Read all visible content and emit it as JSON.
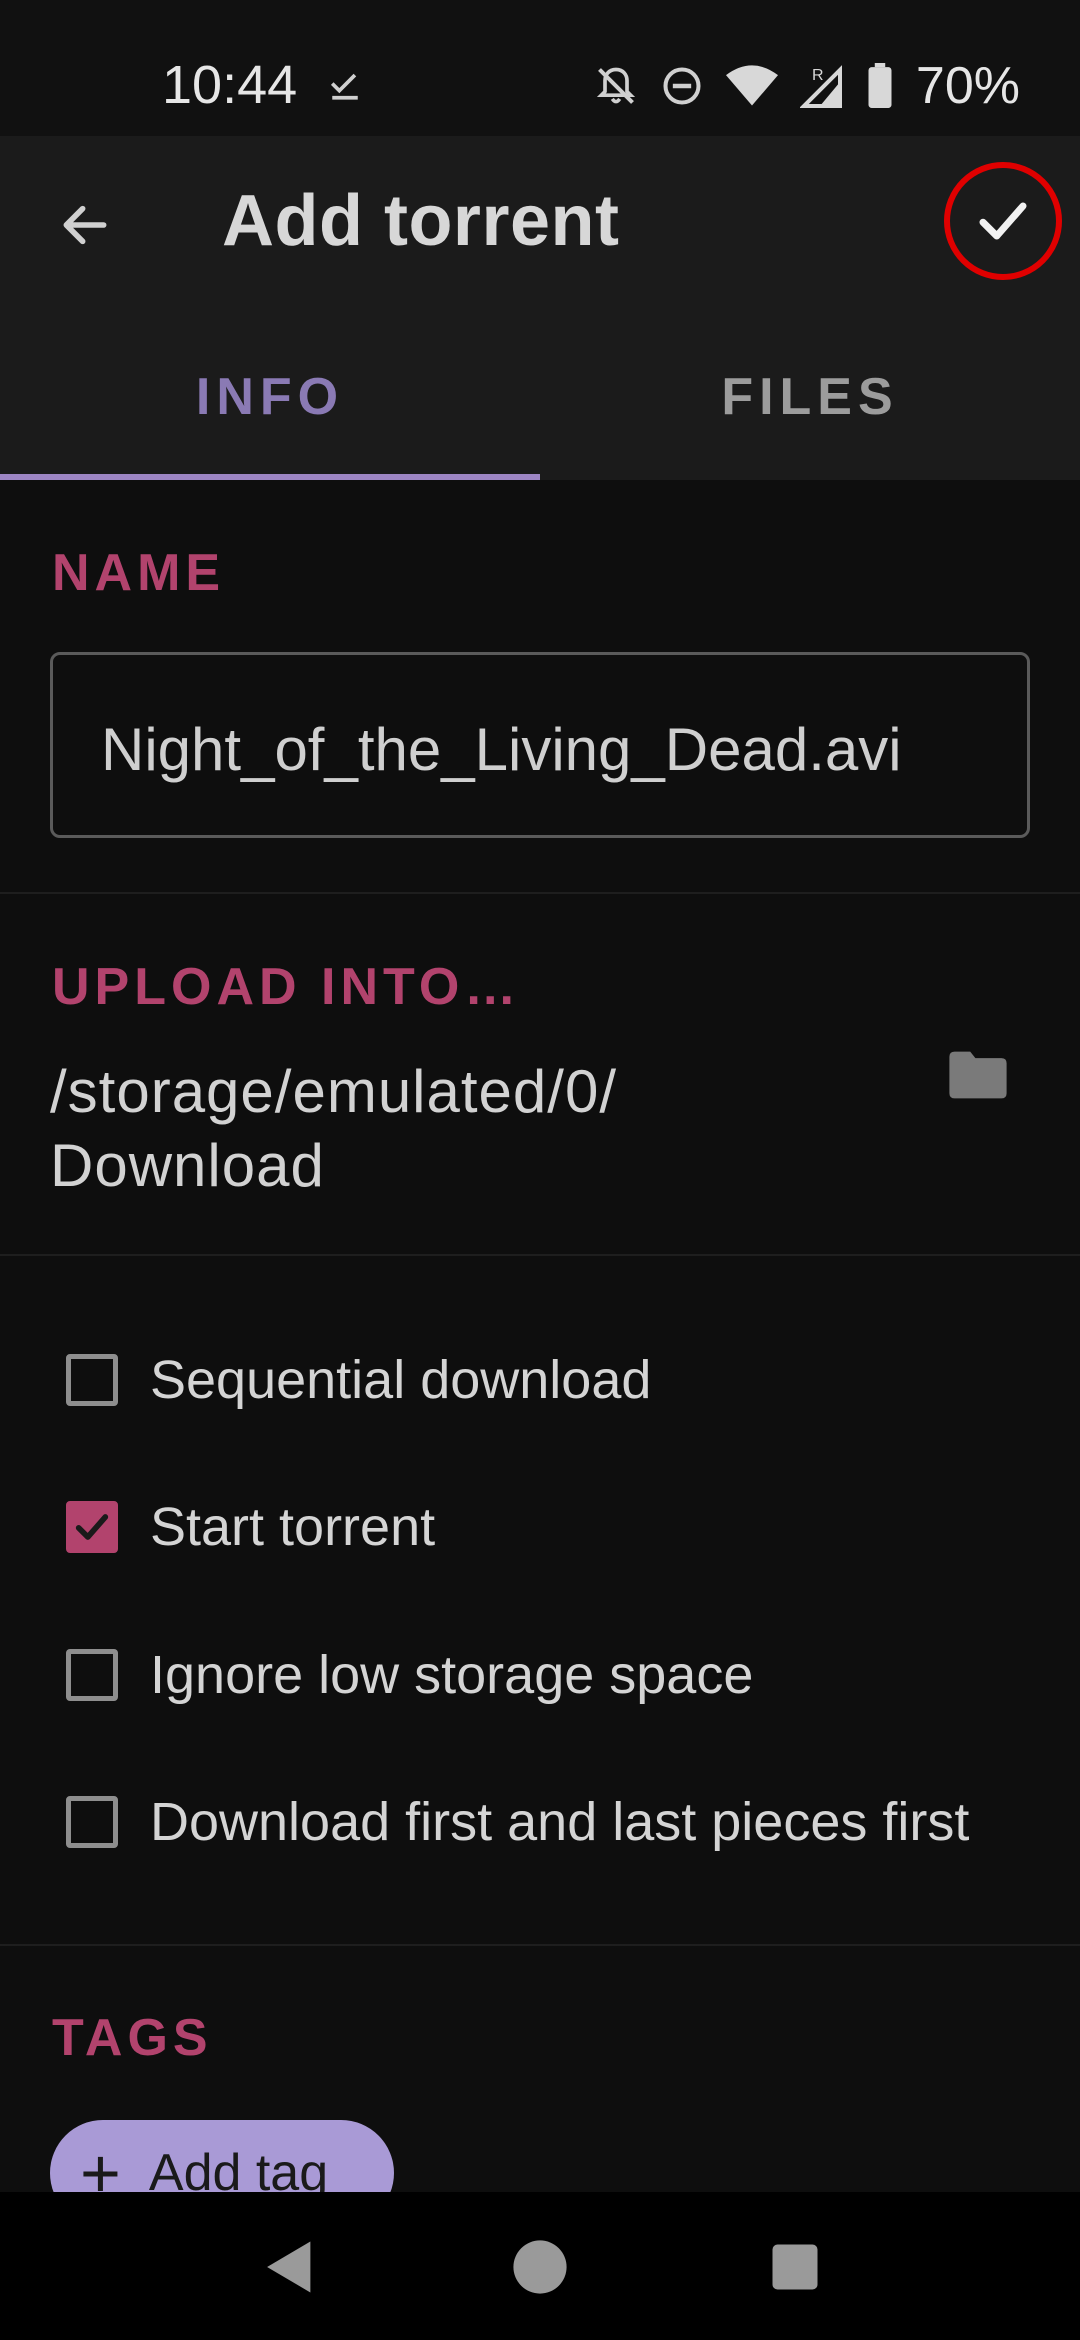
{
  "status_bar": {
    "time": "10:44",
    "battery_percent": "70%",
    "icons": [
      "download-complete-icon",
      "notifications-off-icon",
      "do-not-disturb-icon",
      "wifi-icon",
      "signal-roaming-icon",
      "battery-icon"
    ]
  },
  "app_bar": {
    "title": "Add torrent",
    "back_icon": "arrow-left-icon",
    "confirm_icon": "check-icon"
  },
  "tabs": [
    {
      "label": "INFO",
      "selected": true
    },
    {
      "label": "FILES",
      "selected": false
    }
  ],
  "name_section": {
    "label": "NAME",
    "value": "Night_of_the_Living_Dead.avi"
  },
  "upload_section": {
    "label": "UPLOAD INTO…",
    "path_line1": "/storage/emulated/0/",
    "path_line2": "Download",
    "folder_icon": "folder-icon"
  },
  "options": [
    {
      "label": "Sequential download",
      "checked": false
    },
    {
      "label": "Start torrent",
      "checked": true
    },
    {
      "label": "Ignore low storage space",
      "checked": false
    },
    {
      "label": "Download first and last pieces first",
      "checked": false
    }
  ],
  "tags_section": {
    "label": "TAGS",
    "add_button": "Add tag"
  },
  "colors": {
    "accent": "#b2436d",
    "tab_accent": "#9d86c4",
    "chip": "#a99ad6",
    "confirm_highlight": "#e00000"
  }
}
